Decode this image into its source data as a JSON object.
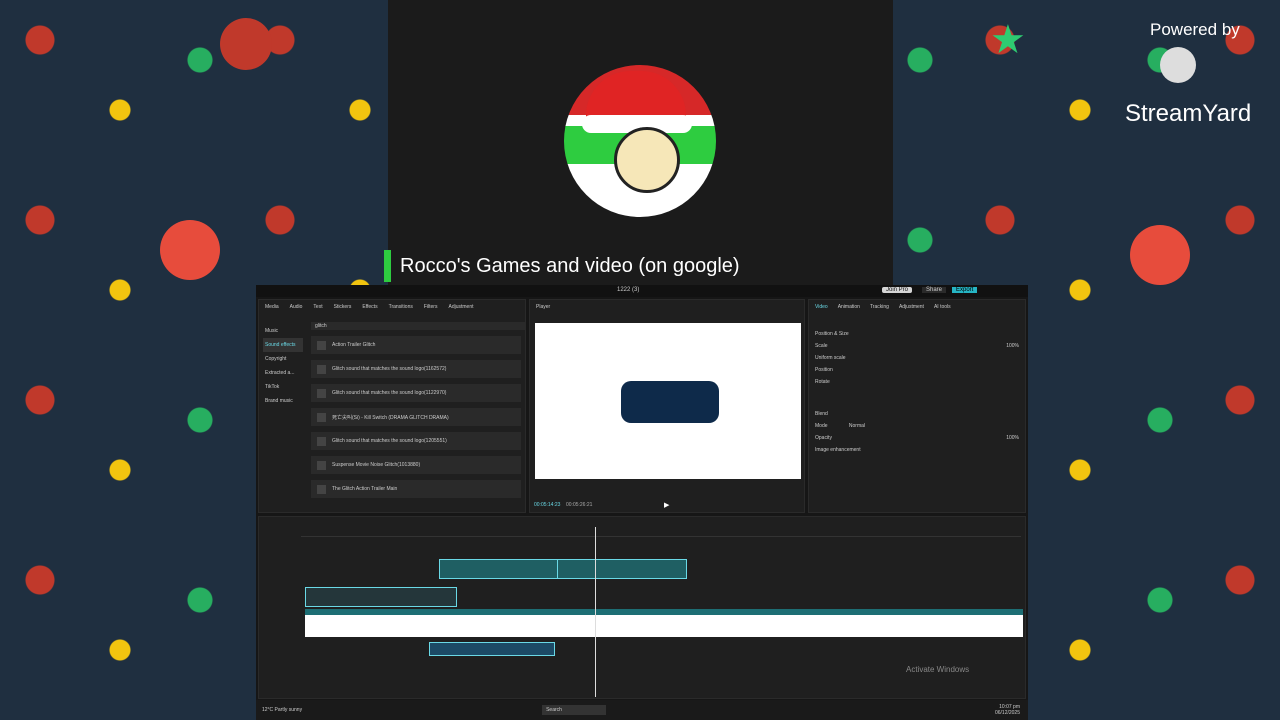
{
  "overlay": {
    "channel_name": "Rocco's Games and video (on google)",
    "powered_by": "Powered by",
    "brand": "StreamYard"
  },
  "app": {
    "title": "1222 (3)",
    "join_pro": "Join Pro",
    "share": "Share",
    "export": "Export",
    "media_tabs": [
      "Media",
      "Audio",
      "Text",
      "Stickers",
      "Effects",
      "Transitions",
      "Filters",
      "Adjustment"
    ],
    "audio_categories": [
      "Music",
      "Sound effects",
      "Copyright",
      "Extracted a...",
      "TikTok",
      "Brand music"
    ],
    "search_value": "glitch",
    "audio_items": [
      "Action Trailer Glitch",
      "Glitch sound that matches the sound logo(1162572)",
      "Glitch sound that matches the sound logo(1122970)",
      "死亡尖叫(Si) - Kill Switch (DRAMA GLITCH DRAMA)",
      "Glitch sound that matches the sound logo(1205551)",
      "Suspense Movie Noise Glitch(1013880)",
      "The Glitch Action Trailer Main"
    ],
    "player_label": "Player",
    "player_time": "00:05:14:23",
    "player_total": "00:05:26:21",
    "props_tabs": [
      "Video",
      "Animation",
      "Tracking",
      "Adjustment",
      "AI tools"
    ],
    "props_rows": [
      "Position & Size",
      "Scale",
      "Uniform scale",
      "Position",
      "Rotate",
      "Blend",
      "Mode",
      "Opacity",
      "Image enhancement"
    ],
    "scale_value": "100%",
    "mode_value": "Normal",
    "opacity_value": "100%"
  },
  "taskbar": {
    "weather": "12°C Partly sunny",
    "search": "Search",
    "time": "10:07 pm",
    "date": "06/12/2025",
    "watermark": "Activate Windows"
  }
}
